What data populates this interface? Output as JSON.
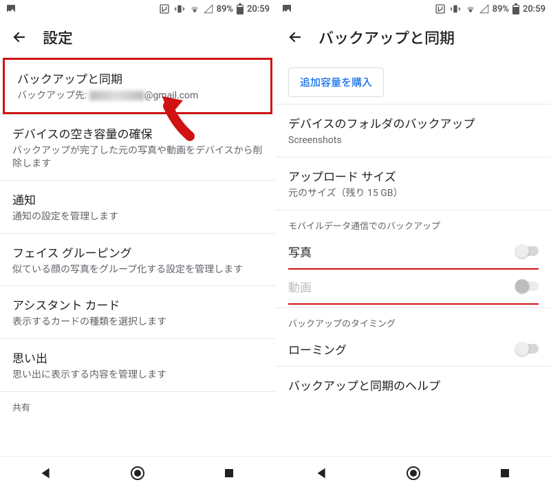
{
  "status": {
    "battery_pct": "89%",
    "time": "20:59"
  },
  "left": {
    "title": "設定",
    "items": [
      {
        "title": "バックアップと同期",
        "sub_prefix": "バックアップ先: ",
        "sub_suffix": "@gmail.com"
      },
      {
        "title": "デバイスの空き容量の確保",
        "sub": "バックアップが完了した元の写真や動画をデバイスから削除します"
      },
      {
        "title": "通知",
        "sub": "通知の設定を管理します"
      },
      {
        "title": "フェイス グルーピング",
        "sub": "似ている顔の写真をグループ化する設定を管理します"
      },
      {
        "title": "アシスタント カード",
        "sub": "表示するカードの種類を選択します"
      },
      {
        "title": "思い出",
        "sub": "思い出に表示する内容を管理します"
      }
    ],
    "share_label": "共有"
  },
  "right": {
    "title": "バックアップと同期",
    "buy_label": "追加容量を購入",
    "items": [
      {
        "title": "デバイスのフォルダのバックアップ",
        "sub": "Screenshots"
      },
      {
        "title": "アップロード サイズ",
        "sub": "元のサイズ（残り 15 GB）"
      }
    ],
    "mobile_section": "モバイルデータ通信でのバックアップ",
    "toggle_photo": "写真",
    "toggle_video": "動画",
    "timing_section": "バックアップのタイミング",
    "toggle_roaming": "ローミング",
    "help_title": "バックアップと同期のヘルプ"
  }
}
